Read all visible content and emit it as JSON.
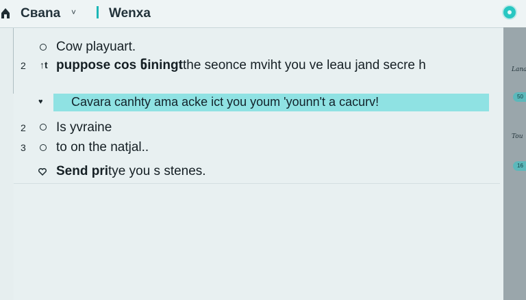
{
  "header": {
    "app_title": "Cвana",
    "chevron": "˅",
    "workspace_title": "Wenxa",
    "home_icon": "home-icon",
    "status_icon": "status-dot-icon",
    "accent_color": "#28c7c2"
  },
  "list": {
    "item1": {
      "marker": "",
      "text": "Cow playuart."
    },
    "item2": {
      "marker": "2",
      "sub_marker": "↑t",
      "bold_text": "puppose cos ნiningt",
      "text": "the seonce mviht you ve leau jand secre h"
    },
    "item3": {
      "marker": "",
      "sub_marker": "♥",
      "text": "Cavara canhty ama acke ict you youm 'younn't a cacurv!"
    },
    "item4": {
      "marker": "2",
      "text": "Is yvraine"
    },
    "item5": {
      "marker": "3",
      "text": "to on the natjal.."
    },
    "item6": {
      "marker": "",
      "bold_text": "Send pri",
      "text": "tye you s stenes."
    }
  },
  "sidebar": {
    "label1": "Lana",
    "pill1": "50",
    "label2": "Tou",
    "pill2": "16"
  },
  "colors": {
    "highlight": "#8fe2e3",
    "sidebar": "#9aa6ab",
    "background": "#e6eeef"
  }
}
